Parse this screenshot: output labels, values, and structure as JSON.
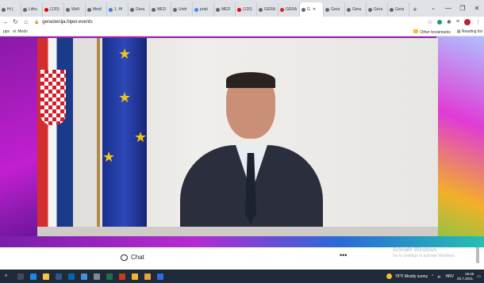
{
  "browser": {
    "tabs": [
      {
        "label": "Hi ("
      },
      {
        "label": "Lithu"
      },
      {
        "label": "(120)"
      },
      {
        "label": "Wefi"
      },
      {
        "label": "Medi"
      },
      {
        "label": "1. Hi"
      },
      {
        "label": "Gera"
      },
      {
        "label": "MED"
      },
      {
        "label": "Unitr"
      },
      {
        "label": "prati"
      },
      {
        "label": "MED"
      },
      {
        "label": "(120)"
      },
      {
        "label": "GERA"
      },
      {
        "label": "GERA"
      },
      {
        "label": "G"
      },
      {
        "label": "Gera"
      },
      {
        "label": "Gera"
      },
      {
        "label": "Gera"
      },
      {
        "label": "Gera"
      }
    ],
    "active_tab_index": 14,
    "address": "gerastenija.hiper.events",
    "bookmarks_left": [
      "pps",
      "Medo"
    ],
    "bookmarks_right": [
      "Other bookmarks",
      "Reading list"
    ]
  },
  "meeting": {
    "chat_label": "Chat",
    "more_label": "•••",
    "watermark_title": "Activate Windows",
    "watermark_sub": "Go to Settings to activate Windows."
  },
  "taskbar": {
    "weather": "79°F  Mostly sunny",
    "lang": "HRV",
    "time": "18:45",
    "date": "20.7.2021."
  },
  "colors": {
    "stage_purple": "#9c1fb3",
    "taskbar": "#1f2a38"
  }
}
